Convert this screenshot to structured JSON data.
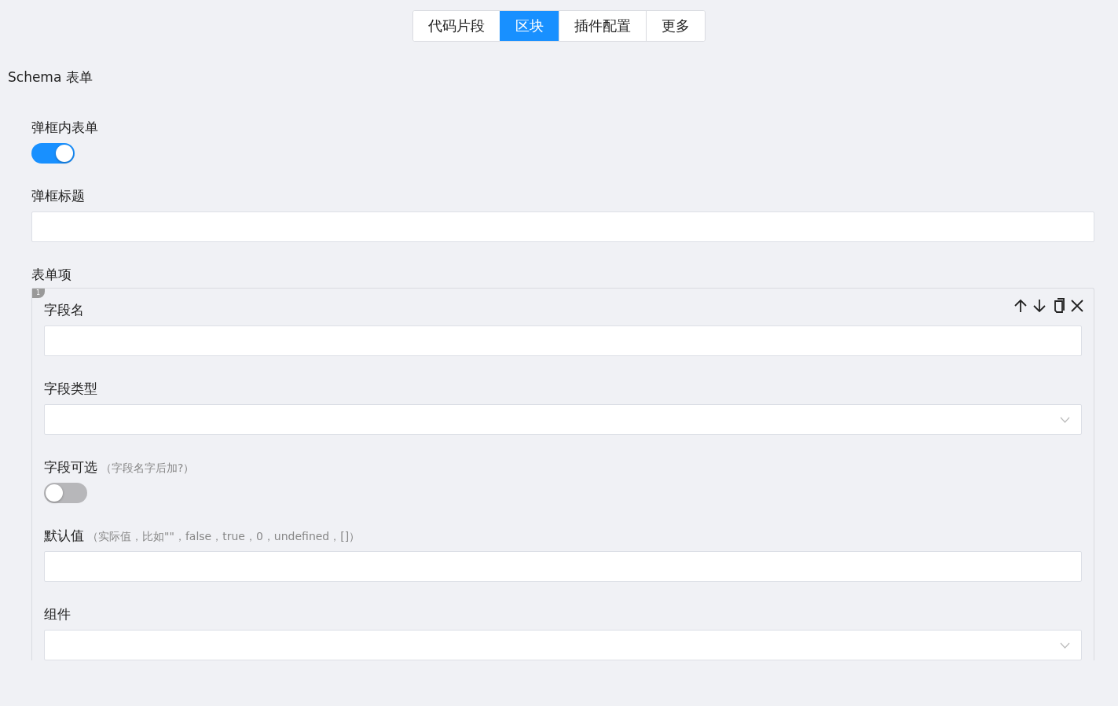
{
  "tabs": [
    {
      "label": "代码片段",
      "selected": false
    },
    {
      "label": "区块",
      "selected": true
    },
    {
      "label": "插件配置",
      "selected": false
    },
    {
      "label": "更多",
      "selected": false
    }
  ],
  "section_title": "Schema 表单",
  "fields": [
    {
      "kind": "switch",
      "label": "弹框内表单",
      "on": true
    },
    {
      "kind": "text",
      "label": "弹框标题"
    }
  ],
  "form_items": {
    "label": "表单项",
    "items": [
      {
        "index": "1",
        "fields": [
          {
            "kind": "text",
            "label": "字段名"
          },
          {
            "kind": "select",
            "label": "字段类型"
          },
          {
            "kind": "switch",
            "label": "字段可选",
            "hint": "（字段名字后加?）",
            "on": false
          },
          {
            "kind": "text",
            "label": "默认值",
            "hint": "（实际值，比如\"\"，false，true，0，undefined，[]）"
          },
          {
            "kind": "select",
            "label": "组件"
          }
        ]
      }
    ]
  }
}
